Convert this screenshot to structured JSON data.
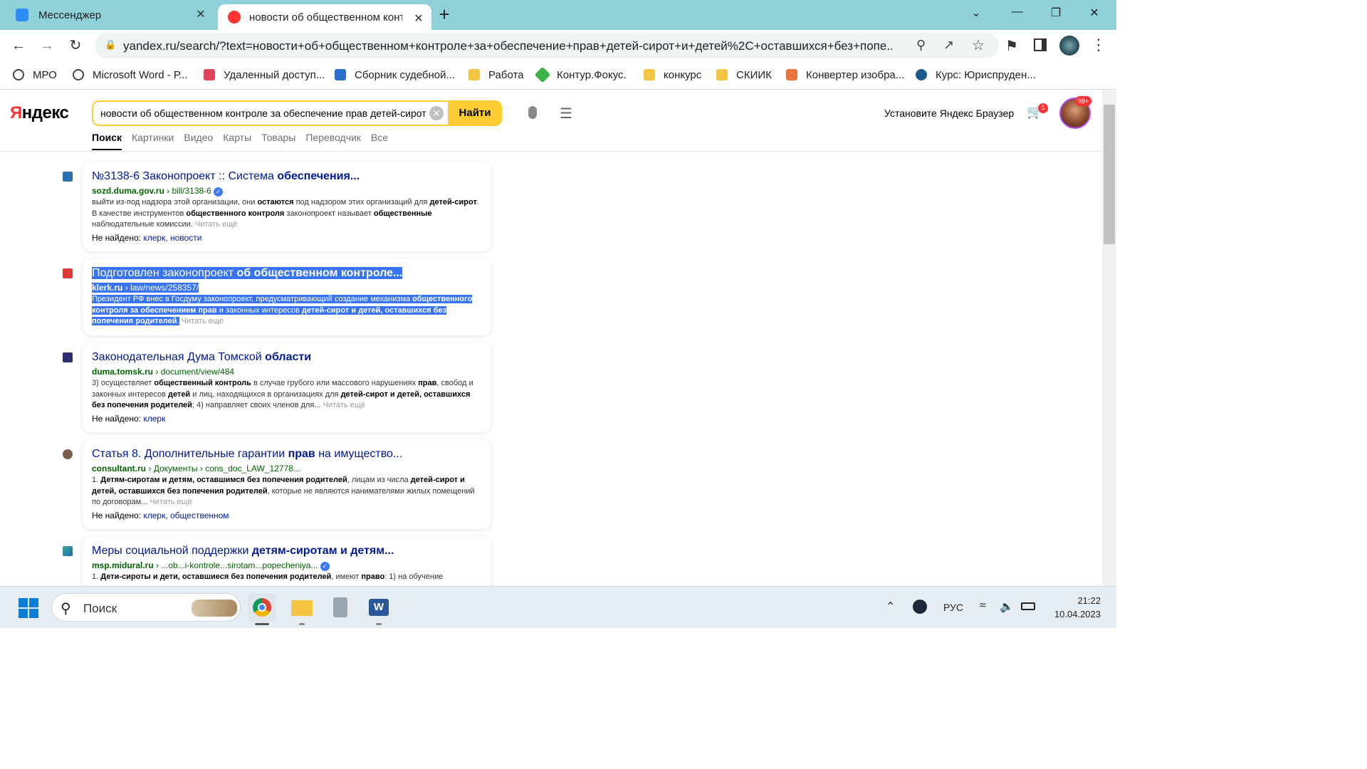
{
  "browser": {
    "tabs": [
      {
        "title": "Мессенджер",
        "close": "✕"
      },
      {
        "title": "новости об общественном конт",
        "close": "✕"
      }
    ],
    "new_tab": "+",
    "window_controls": {
      "chevron": "⌄",
      "minimize": "—",
      "restore": "❐",
      "close": "✕"
    },
    "url": "yandex.ru/search/?text=новости+об+общественном+контроле+за+обеспечение+прав+детей-сирот+и+детей%2C+оставшихся+без+попе...",
    "bookmarks": [
      "МРО",
      "Microsoft Word - Р...",
      "Удаленный доступ...",
      "Сборник судебной...",
      "Работа",
      "Контур.Фокус.",
      "конкурс",
      "СКИИК",
      "Конвертер изобра...",
      "Курс: Юриспруден..."
    ]
  },
  "yandex": {
    "logo_a": "Я",
    "logo_b": "ндекс",
    "query": "новости об общественном контроле за обеспечение прав детей-сирот и детей",
    "clear": "✕",
    "find_button": "Найти",
    "tabs": [
      "Поиск",
      "Картинки",
      "Видео",
      "Карты",
      "Товары",
      "Переводчик",
      "Все"
    ],
    "install_browser": "Установите Яндекс Браузер",
    "cart_badge": "1",
    "avatar_badge": "99+",
    "results": [
      {
        "title_plain": "№3138-6 Законопроект :: Система ",
        "title_bold": "обеспечения...",
        "domain": "sozd.duma.gov.ru",
        "path": "bill/3138-6",
        "verified": true,
        "snippet_parts": [
          "выйти из-под надзора этой организации, они ",
          "остаются",
          " под надзором этих организаций для ",
          "детей-сирот",
          ". В качестве инструментов ",
          "общественного контроля",
          " законопроект называет ",
          "общественные",
          " наблюдательные комиссии."
        ],
        "more": "Читать ещё",
        "not_found_label": "Не найдено:",
        "not_found_words": "клерк, новости"
      },
      {
        "title_plain": "Подготовлен законопроект ",
        "title_bold": "об общественном контроле...",
        "domain": "klerk.ru",
        "path": "law/news/258357/",
        "snippet_parts": [
          "Президент РФ внес в Госдуму законопроект, предусматривающий создание механизма ",
          "общественного контроля за обеспечением прав",
          " и законных интересов ",
          "детей-сирот и детей, оставшихся без попечения родителей",
          "."
        ],
        "more": "Читать ещё"
      },
      {
        "title_plain": "Законодательная Дума Томской ",
        "title_bold": "области",
        "domain": "duma.tomsk.ru",
        "path": "document/view/484",
        "snippet_parts": [
          "3) осуществляет ",
          "общественный контроль",
          " в случае грубого или массового нарушениях ",
          "прав",
          ", свобод и законных интересов ",
          "детей",
          " и лиц, находящихся в организациях для ",
          "детей-сирот и детей, оставшихся без попечения родителей",
          "; 4) направляет своих членов для..."
        ],
        "more": "Читать ещё",
        "not_found_label": "Не найдено:",
        "not_found_words": "клерк"
      },
      {
        "title_plain": "Статья 8. Дополнительные гарантии ",
        "title_bold": "прав",
        "title_rest": " на имущество...",
        "domain": "consultant.ru",
        "path": "Документы › cons_doc_LAW_12778...",
        "snippet_parts": [
          "1. ",
          "Детям-сиротам и детям, оставшимся без попечения родителей",
          ", лицам из числа ",
          "детей-сирот и детей, оставшихся без попечения родителей",
          ", которые не являются нанимателями жилых помещений по договорам..."
        ],
        "more": "Читать ещё",
        "not_found_label": "Не найдено:",
        "not_found_words": "клерк, общественном"
      },
      {
        "title_plain": "Меры социальной поддержки ",
        "title_bold": "детям-сиротам и детям...",
        "domain": "msp.midural.ru",
        "path": "...ob...i-kontrole...sirotam...popecheniya...",
        "verified": true,
        "snippet_parts": [
          "1. ",
          "Дети-сироты и дети, оставшиеся без попечения родителей",
          ", имеют ",
          "право",
          ": 1) на обучение"
        ]
      }
    ]
  },
  "taskbar": {
    "search_label": "Поиск",
    "language": "РУС",
    "time": "21:22",
    "date": "10.04.2023"
  }
}
